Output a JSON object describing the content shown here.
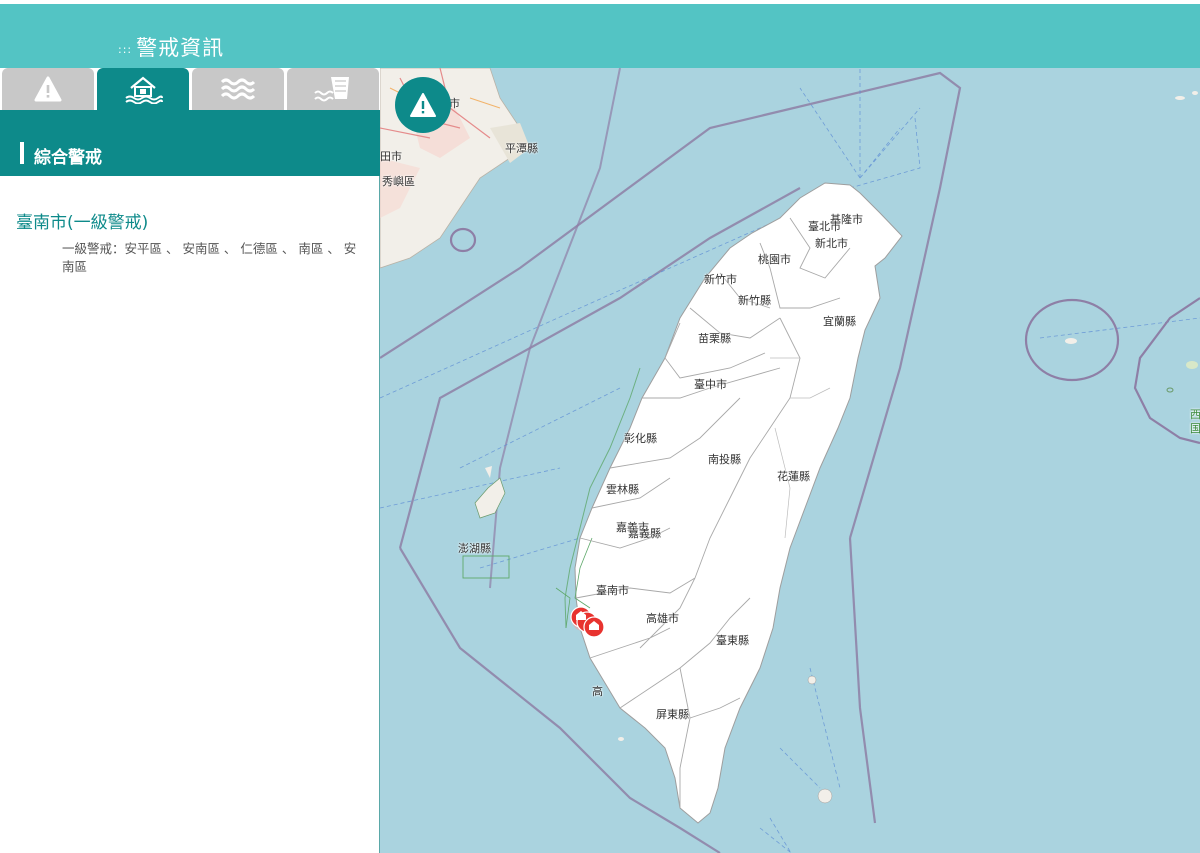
{
  "header": {
    "menu_icon": ":::",
    "title": "警戒資訊"
  },
  "tabs": [
    {
      "icon": "warning-icon",
      "active": false
    },
    {
      "icon": "flood-house-icon",
      "active": true
    },
    {
      "icon": "waves-icon",
      "active": false
    },
    {
      "icon": "dam-icon",
      "active": false
    }
  ],
  "panel": {
    "heading": "綜合警戒",
    "warnings": [
      {
        "city": "臺南市(一級警戒)",
        "detail": "一級警戒：安平區 、 安南區 、 仁德區 、 南區 、 安南區"
      }
    ]
  },
  "map": {
    "labels": {
      "keelung": "基隆市",
      "taipei": "臺北市",
      "newtaipei": "新北市",
      "taoyuan": "桃園市",
      "hsinchu_city": "新竹市",
      "hsinchu_county": "新竹縣",
      "yilan": "宜蘭縣",
      "miaoli": "苗栗縣",
      "taichung": "臺中市",
      "changhua": "彰化縣",
      "nantou": "南投縣",
      "hualien": "花蓮縣",
      "yunlin": "雲林縣",
      "chiayi_city": "嘉義市",
      "chiayi_county": "嘉義縣",
      "penghu": "澎湖縣",
      "tainan": "臺南市",
      "kaohsiung": "高雄市",
      "kaohsiung_short": "高",
      "taitung": "臺東縣",
      "pingtung": "屏東縣",
      "pingtan": "平潭縣",
      "putian": "田市",
      "xiuyu": "秀嶼區",
      "fuqing": "清市",
      "east_partial_1": "西",
      "east_partial_2": "国"
    },
    "colors": {
      "sea": "#aad3df",
      "land": "#ffffff",
      "mainland": "#f2efe9",
      "border": "#8e7fa6",
      "alert": "#e8332f"
    }
  }
}
